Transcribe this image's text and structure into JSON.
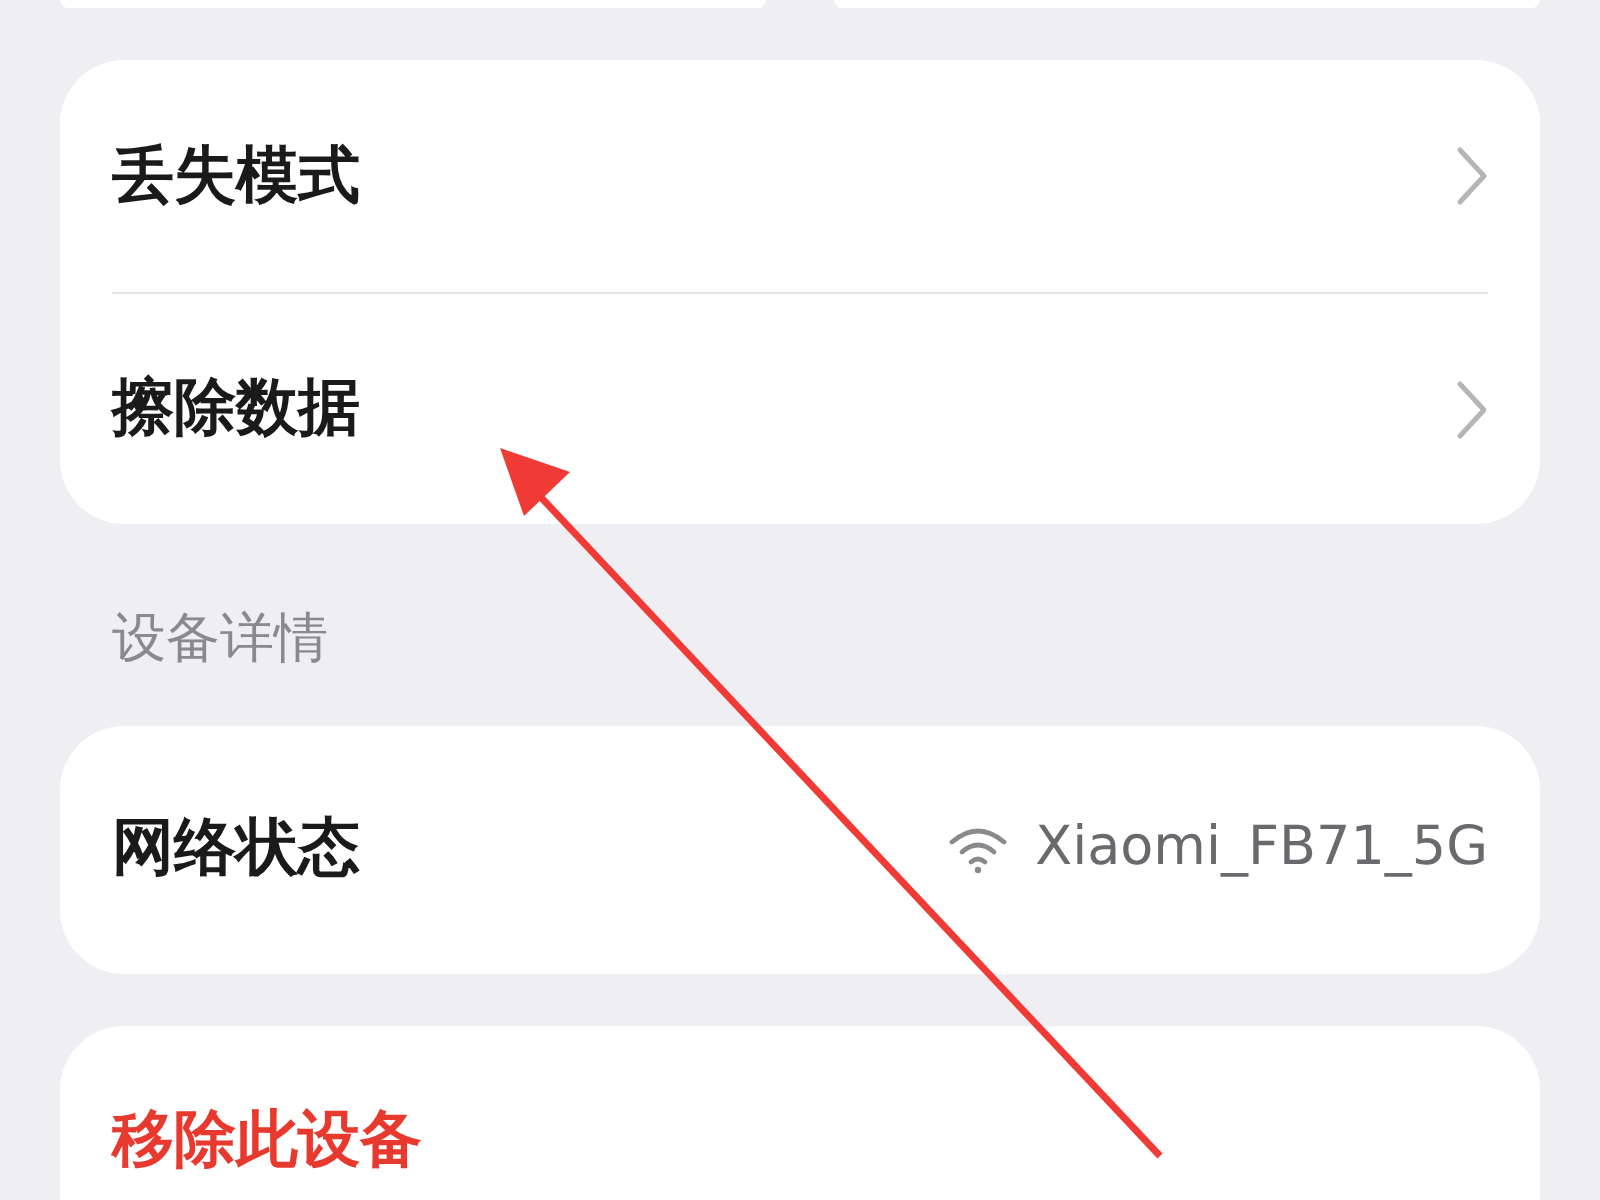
{
  "menu_items": [
    {
      "label": "丢失模式"
    },
    {
      "label": "擦除数据"
    }
  ],
  "section_title": "设备详情",
  "network": {
    "label": "网络状态",
    "value": "Xiaomi_FB71_5G"
  },
  "remove_button": {
    "label": "移除此设备"
  }
}
